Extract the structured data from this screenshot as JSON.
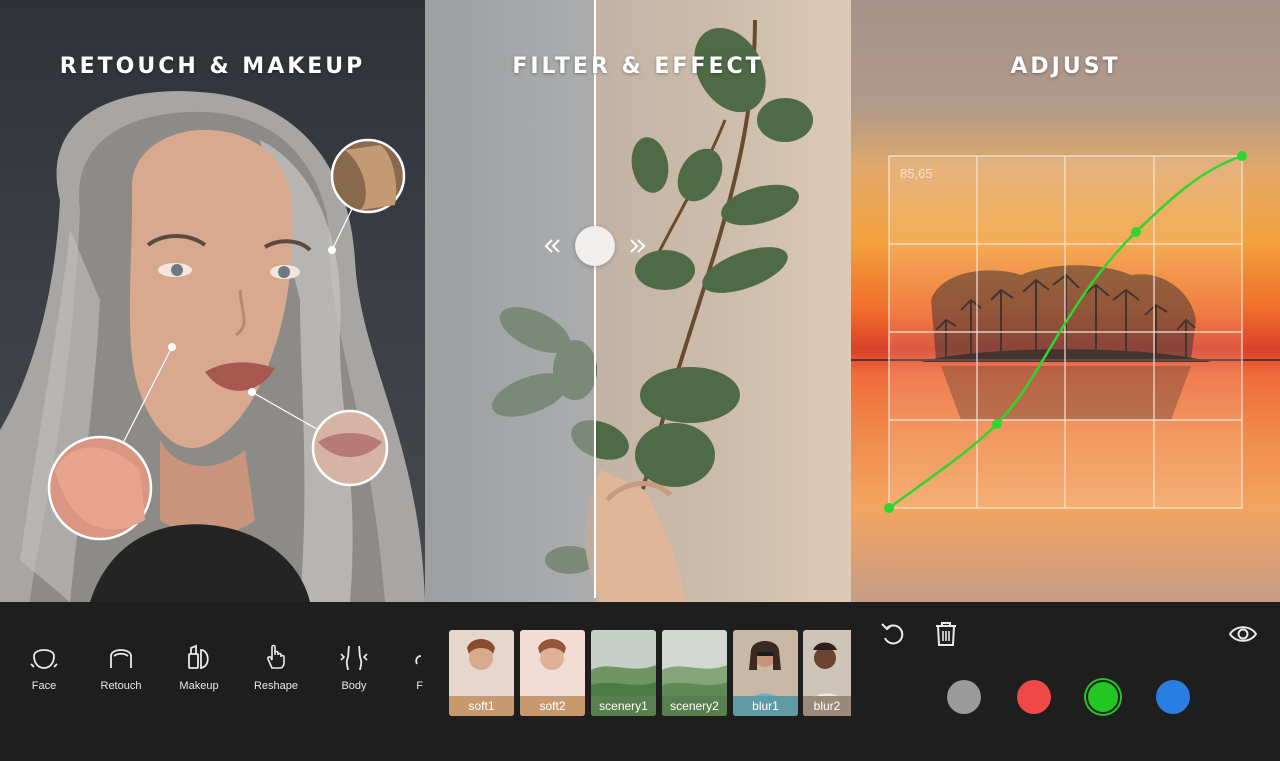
{
  "panels": {
    "retouch": {
      "title": "RETOUCH & MAKEUP",
      "tools": [
        {
          "label": "Face",
          "icon": "face-contour-icon"
        },
        {
          "label": "Retouch",
          "icon": "retouch-icon"
        },
        {
          "label": "Makeup",
          "icon": "makeup-icon"
        },
        {
          "label": "Reshape",
          "icon": "reshape-hand-icon"
        },
        {
          "label": "Body",
          "icon": "body-icon"
        },
        {
          "label": "F",
          "icon": "partial-tool-icon"
        }
      ]
    },
    "filter": {
      "title": "FILTER & EFFECT",
      "filters": [
        {
          "label": "soft1",
          "label_color": "#c69a6e"
        },
        {
          "label": "soft2",
          "label_color": "#c69a6e"
        },
        {
          "label": "scenery1",
          "label_color": "#5a7f4e"
        },
        {
          "label": "scenery2",
          "label_color": "#5a7f4e"
        },
        {
          "label": "blur1",
          "label_color": "#5f9aa5"
        },
        {
          "label": "blur2",
          "label_color": "#9b8a7a"
        }
      ]
    },
    "adjust": {
      "title": "ADJUST",
      "curve_readout": "85,65",
      "curve_color": "#2fd62f",
      "color_channels": [
        {
          "name": "gray",
          "color": "#9a9a9a",
          "selected": false
        },
        {
          "name": "red",
          "color": "#f04848",
          "selected": false
        },
        {
          "name": "green",
          "color": "#22c722",
          "selected": true
        },
        {
          "name": "blue",
          "color": "#2a7de1",
          "selected": false
        }
      ],
      "toolbar_icons": [
        "undo-icon",
        "trash-icon",
        "eye-icon"
      ]
    }
  }
}
